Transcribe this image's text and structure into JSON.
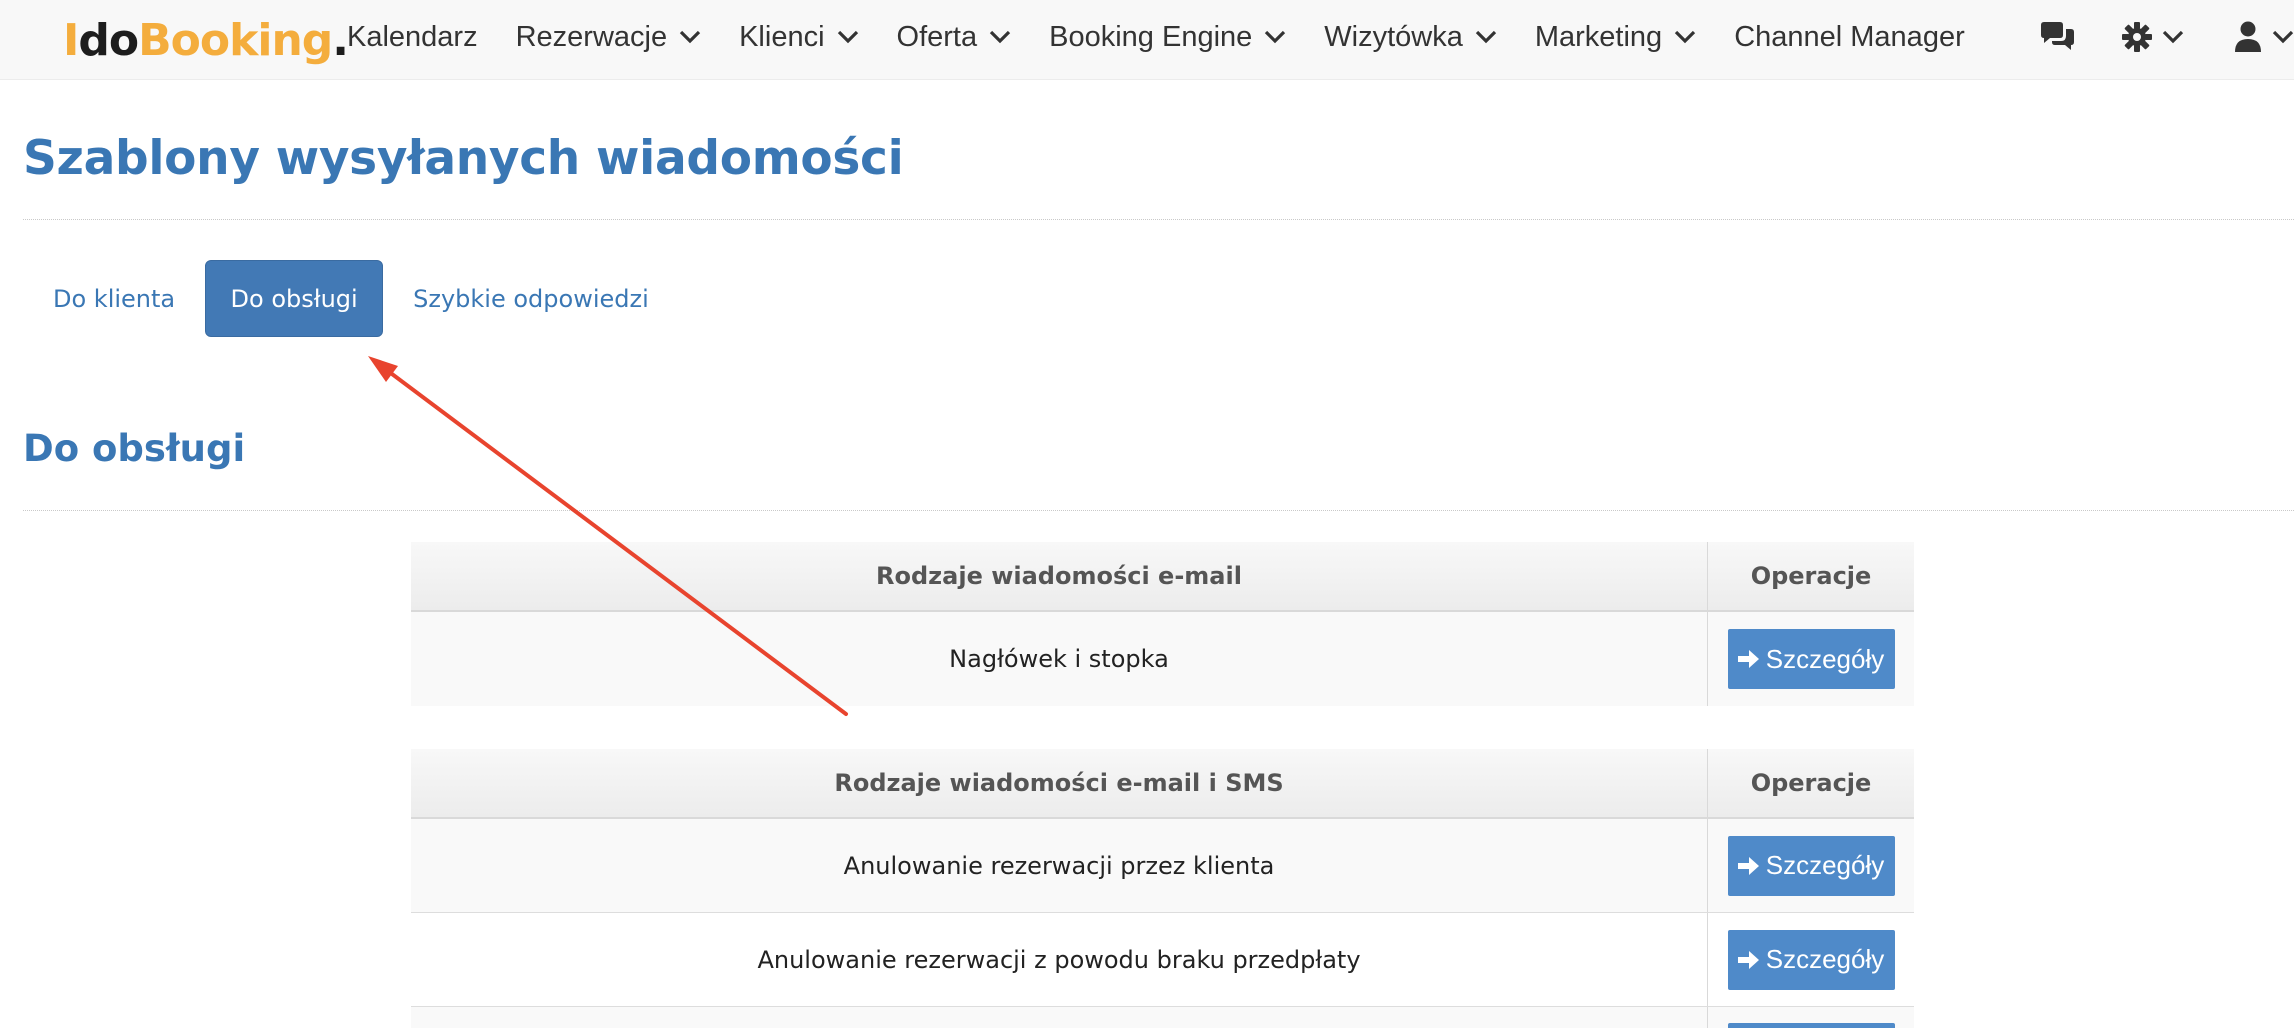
{
  "app": {
    "logo": {
      "part1": "I",
      "part2": "do",
      "part3": "Booking",
      "part4": "."
    }
  },
  "nav": {
    "items": [
      {
        "label": "Kalendarz",
        "dropdown": false
      },
      {
        "label": "Rezerwacje",
        "dropdown": true
      },
      {
        "label": "Klienci",
        "dropdown": true
      },
      {
        "label": "Oferta",
        "dropdown": true
      },
      {
        "label": "Booking Engine",
        "dropdown": true
      },
      {
        "label": "Wizytówka",
        "dropdown": true
      },
      {
        "label": "Marketing",
        "dropdown": true
      },
      {
        "label": "Channel Manager",
        "dropdown": false
      }
    ],
    "icons": [
      "chat-icon",
      "gear-icon",
      "user-icon"
    ]
  },
  "page": {
    "title": "Szablony wysyłanych wiadomości",
    "tabs": [
      {
        "label": "Do klienta",
        "active": false
      },
      {
        "label": "Do obsługi",
        "active": true
      },
      {
        "label": "Szybkie odpowiedzi",
        "active": false
      }
    ],
    "section_title": "Do obsługi"
  },
  "tables": [
    {
      "header": {
        "col1": "Rodzaje wiadomości e-mail",
        "col2": "Operacje"
      },
      "rows": [
        {
          "name": "Nagłówek i stopka",
          "button": "Szczegóły"
        }
      ]
    },
    {
      "header": {
        "col1": "Rodzaje wiadomości e-mail i SMS",
        "col2": "Operacje"
      },
      "rows": [
        {
          "name": "Anulowanie rezerwacji przez klienta",
          "button": "Szczegóły"
        },
        {
          "name": "Anulowanie rezerwacji z powodu braku przedpłaty",
          "button": "Szczegóły"
        }
      ]
    }
  ],
  "colors": {
    "accent": "#3a77b4",
    "button": "#4f8ac9",
    "logo_orange": "#f4ad3d",
    "annotation_arrow": "#e8442e"
  }
}
